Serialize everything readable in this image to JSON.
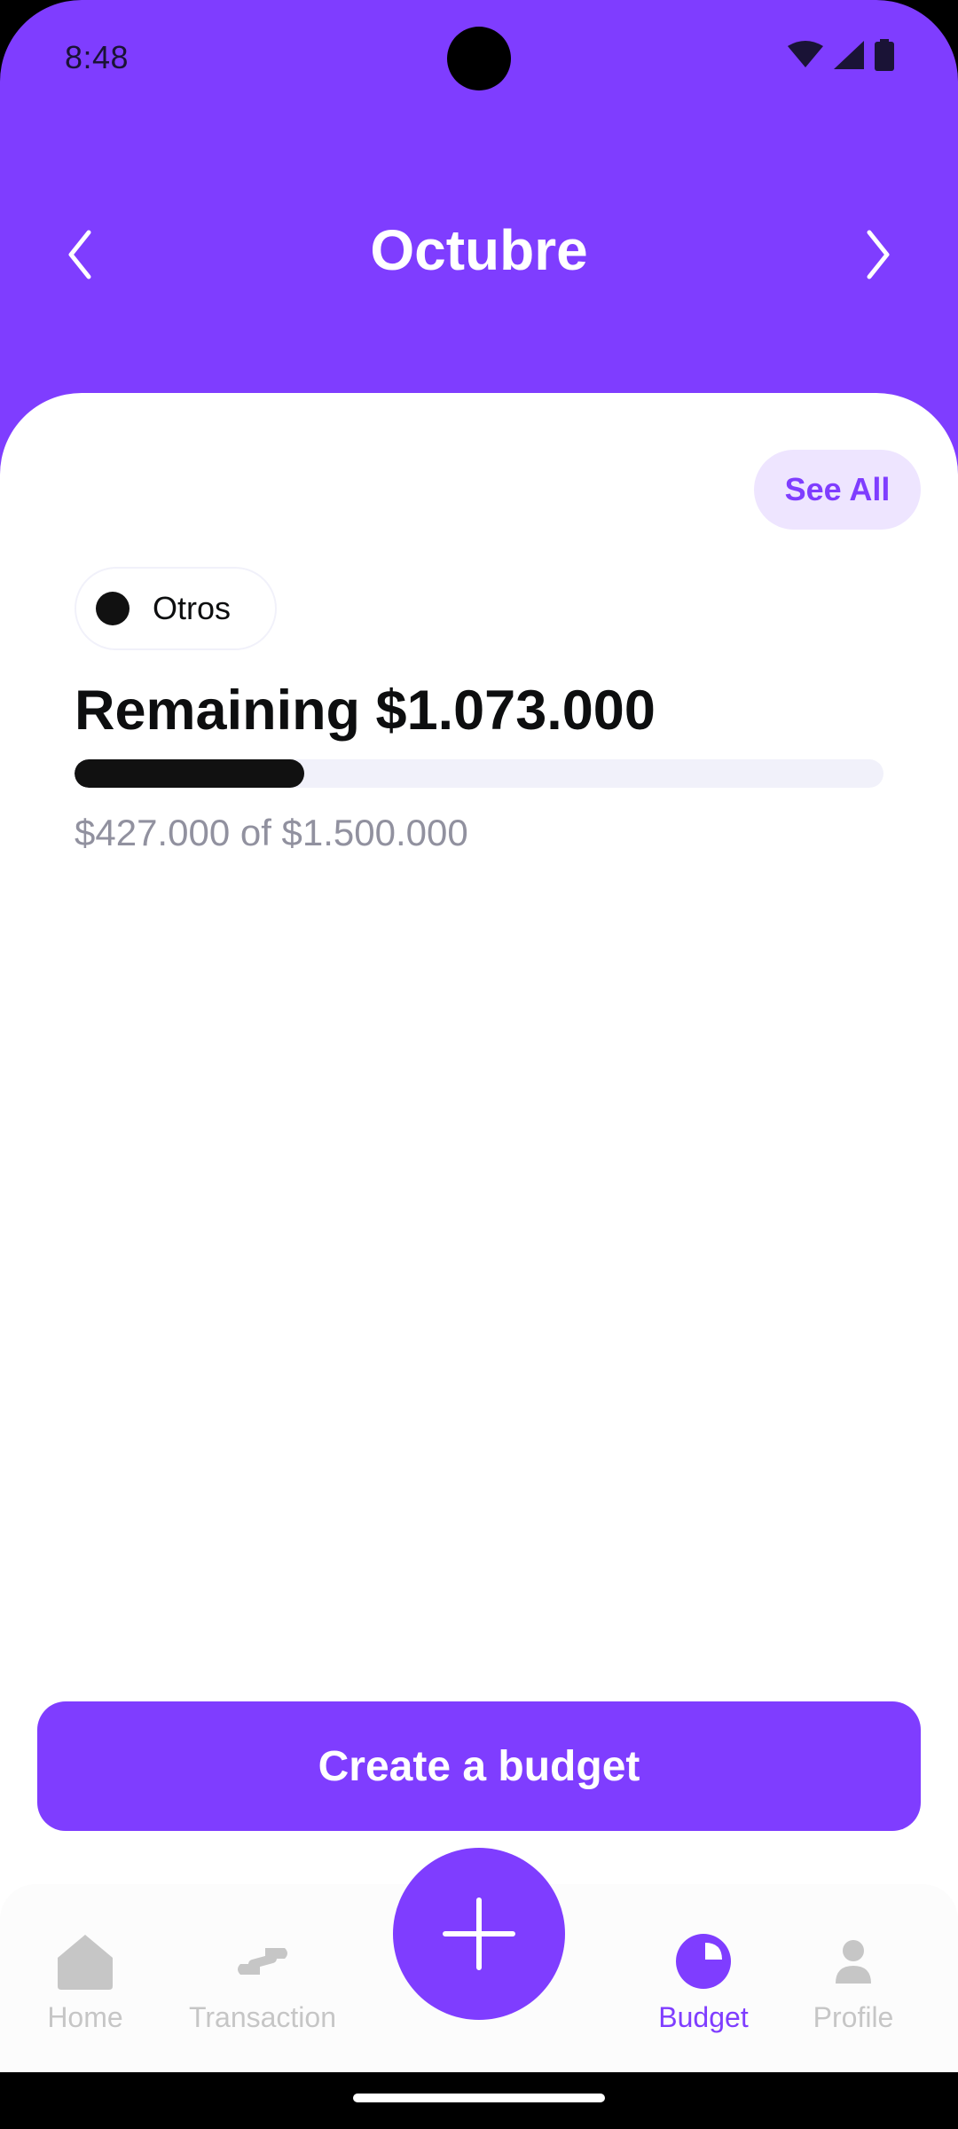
{
  "status_bar": {
    "time": "8:48"
  },
  "header": {
    "title": "Octubre"
  },
  "budget": {
    "see_all_label": "See All",
    "category": "Otros",
    "remaining_text": "Remaining $1.073.000",
    "progress": 0.284,
    "amount_text": "$427.000 of $1.500.000"
  },
  "create_button_label": "Create a budget",
  "bottom_nav": {
    "items": [
      {
        "label": "Home",
        "icon": "home-icon"
      },
      {
        "label": "Transaction",
        "icon": "transaction-icon"
      },
      {
        "label": "Budget",
        "icon": "pie-chart-icon"
      },
      {
        "label": "Profile",
        "icon": "user-icon"
      }
    ],
    "active": "Budget"
  },
  "colors": {
    "primary": "#7F3DFF",
    "light_primary": "#EEE5FF",
    "dark": "#0D0E0F",
    "inactive": "#C6C6C6",
    "muted_text": "#91919F"
  }
}
